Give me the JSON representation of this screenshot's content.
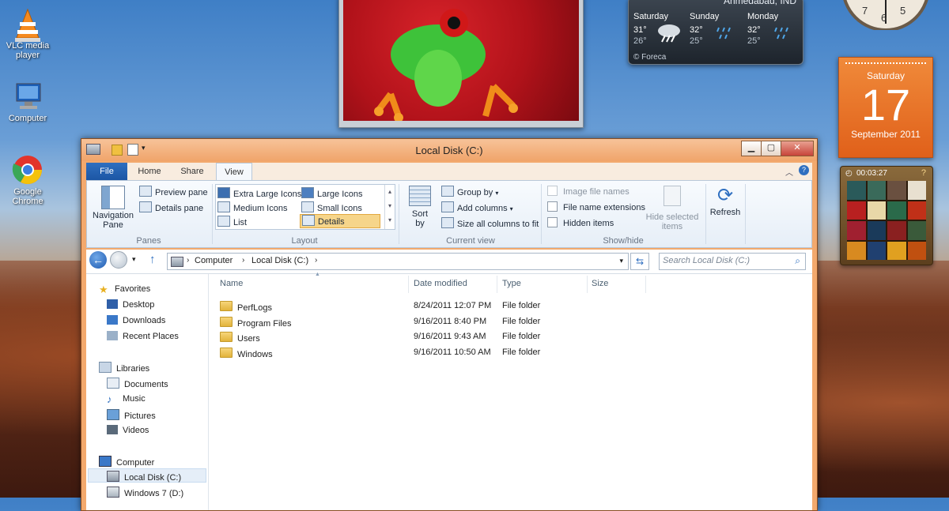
{
  "desktop": {
    "icons": [
      {
        "label": "VLC media player"
      },
      {
        "label": "Computer"
      },
      {
        "label": "Google Chrome"
      }
    ]
  },
  "weather": {
    "location": "Ahmedabad, IND",
    "days": [
      {
        "name": "Saturday",
        "high": "31°",
        "low": "26°"
      },
      {
        "name": "Sunday",
        "high": "32°",
        "low": "25°"
      },
      {
        "name": "Monday",
        "high": "32°",
        "low": "25°"
      }
    ],
    "credit": "© Foreca"
  },
  "clock": {
    "digits": [
      "7",
      "6",
      "5"
    ]
  },
  "calendar": {
    "weekday": "Saturday",
    "day": "17",
    "month_year": "September 2011"
  },
  "puzzle": {
    "timer": "00:03:27"
  },
  "window": {
    "title": "Local Disk (C:)",
    "tabs": [
      {
        "label": "File"
      },
      {
        "label": "Home"
      },
      {
        "label": "Share"
      },
      {
        "label": "View"
      }
    ],
    "ribbon": {
      "panes": {
        "navigation_pane": "Navigation",
        "navigation_pane2": "Pane",
        "preview_pane": "Preview pane",
        "details_pane": "Details pane",
        "group_label": "Panes"
      },
      "layout": {
        "options": [
          "Extra Large Icons",
          "Large Icons",
          "Medium Icons",
          "Small Icons",
          "List",
          "Details"
        ],
        "selected": "Details",
        "group_label": "Layout"
      },
      "current_view": {
        "sort_by": "Sort",
        "sort_by2": "by",
        "group_by": "Group by",
        "add_columns": "Add columns",
        "size_columns": "Size all columns to fit",
        "group_label": "Current view"
      },
      "show_hide": {
        "image_file_names": "Image file names",
        "file_name_extensions": "File name extensions",
        "hidden_items": "Hidden items",
        "hide_selected": "Hide selected",
        "hide_selected2": "items",
        "group_label": "Show/hide"
      },
      "refresh": "Refresh"
    },
    "address": {
      "crumbs": [
        "Computer",
        "Local Disk (C:)"
      ]
    },
    "search": {
      "placeholder": "Search Local Disk (C:)"
    },
    "nav": {
      "favorites": "Favorites",
      "favorite_items": [
        "Desktop",
        "Downloads",
        "Recent Places"
      ],
      "libraries": "Libraries",
      "library_items": [
        "Documents",
        "Music",
        "Pictures",
        "Videos"
      ],
      "computer": "Computer",
      "computer_items": [
        "Local Disk (C:)",
        "Windows 7 (D:)"
      ]
    },
    "columns": [
      "Name",
      "Date modified",
      "Type",
      "Size"
    ],
    "files": [
      {
        "name": "PerfLogs",
        "date": "8/24/2011 12:07 PM",
        "type": "File folder"
      },
      {
        "name": "Program Files",
        "date": "9/16/2011 8:40 PM",
        "type": "File folder"
      },
      {
        "name": "Users",
        "date": "9/16/2011 9:43 AM",
        "type": "File folder"
      },
      {
        "name": "Windows",
        "date": "9/16/2011 10:50 AM",
        "type": "File folder"
      }
    ]
  },
  "colors": {
    "titlebar": "#f0a46a",
    "file_tab": "#1c56a4",
    "calendar": "#e0601a",
    "selected_layout": "#f6d58a"
  }
}
